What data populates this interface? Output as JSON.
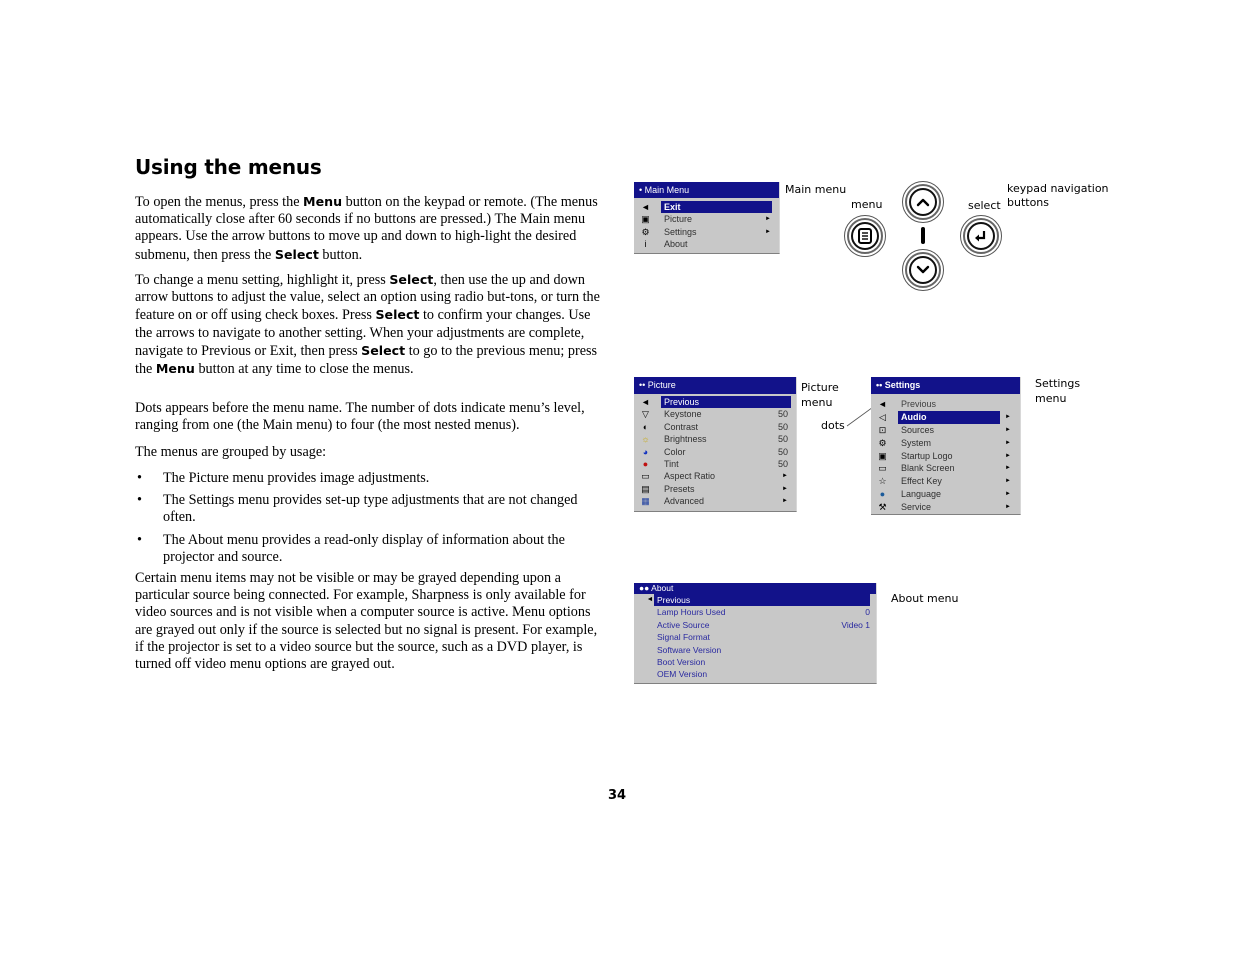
{
  "title": "Using the menus",
  "paragraphs": {
    "p1": [
      {
        "t": "To open the menus, press the "
      },
      {
        "b": "Menu"
      },
      {
        "t": " button on the keypad or remote. (The menus automatically close after 60 seconds if no buttons are pressed.) The Main menu appears. Use the arrow buttons to move up and down to high-light the desired submenu, then press the "
      },
      {
        "b": "Select"
      },
      {
        "t": " button."
      }
    ],
    "p2": [
      {
        "t": "To change a menu setting, highlight it, press "
      },
      {
        "b": "Select"
      },
      {
        "t": ", then use the up and down arrow buttons to adjust the value, select an option using radio but-tons, or turn the feature on or off using check boxes. Press "
      },
      {
        "b": "Select"
      },
      {
        "t": " to confirm your changes. Use the arrows to navigate to another setting. When your adjustments are complete, navigate to Previous or Exit, then press "
      },
      {
        "b": "Select"
      },
      {
        "t": " to go to the previous menu; press the "
      },
      {
        "b": "Menu"
      },
      {
        "t": " button at any time to close the menus."
      }
    ],
    "p3": "Dots appears before the menu name. The number of dots indicate menu’s level, ranging from one (the Main menu) to four (the most nested menus).",
    "p4": "The menus are grouped by usage:",
    "p5": "Certain menu items may not be visible or may be grayed depending upon a particular source being connected. For example, Sharpness is only available for video sources and is not visible when a computer source is active. Menu options are grayed out only if the source is selected but no signal is present. For example, if the projector is set to a video source but the source, such as a DVD player, is turned off video menu options are grayed out."
  },
  "bullets": [
    "The Picture menu provides image adjustments.",
    "The Settings menu provides set-up type adjustments that are not changed often.",
    "The About menu provides a read-only display of information about the projector and source."
  ],
  "bullet_glyph": "•",
  "page_number": "34",
  "labels": {
    "main_menu": "Main menu",
    "menu_key": "menu",
    "select_key": "select",
    "keypad_nav": "keypad navigation",
    "keypad_nav2": "buttons",
    "picture_menu": "Picture",
    "picture_menu2": "menu",
    "dots": "dots",
    "settings_menu": "Settings",
    "settings_menu2": "menu",
    "about_menu": "About menu"
  },
  "colors": {
    "osd_header": "#12128a",
    "osd_background": "#c8c8c8",
    "about_text": "#2a2aa0"
  },
  "main_menu": {
    "header": "•  Main Menu",
    "items": [
      {
        "icon": "◄",
        "icon_name": "back-arrow-icon",
        "label": "Exit",
        "selected": true,
        "submenu": ""
      },
      {
        "icon": "▣",
        "icon_name": "picture-icon",
        "label": "Picture",
        "selected": false,
        "submenu": "►"
      },
      {
        "icon": "⚙",
        "icon_name": "settings-icon",
        "label": "Settings",
        "selected": false,
        "submenu": "►"
      },
      {
        "icon": "i",
        "icon_name": "info-icon",
        "label": "About",
        "selected": false,
        "submenu": ""
      }
    ]
  },
  "picture_menu": {
    "header": "••  Picture",
    "items": [
      {
        "icon": "◄",
        "icon_name": "back-arrow-icon",
        "label": "Previous",
        "selected": true,
        "value": "",
        "submenu": ""
      },
      {
        "icon": "▽",
        "icon_name": "keystone-icon",
        "label": "Keystone",
        "value": "50",
        "submenu": ""
      },
      {
        "icon": "◐",
        "icon_name": "contrast-icon",
        "label": "Contrast",
        "value": "50",
        "submenu": ""
      },
      {
        "icon": "☼",
        "icon_name": "brightness-icon",
        "label": "Brightness",
        "value": "50",
        "submenu": ""
      },
      {
        "icon": "◕",
        "icon_name": "color-icon",
        "label": "Color",
        "value": "50",
        "submenu": ""
      },
      {
        "icon": "●",
        "icon_name": "tint-icon",
        "label": "Tint",
        "value": "50",
        "submenu": ""
      },
      {
        "icon": "▭",
        "icon_name": "aspect-ratio-icon",
        "label": "Aspect Ratio",
        "value": "",
        "submenu": "►"
      },
      {
        "icon": "▤",
        "icon_name": "presets-icon",
        "label": "Presets",
        "value": "",
        "submenu": "►"
      },
      {
        "icon": "▦",
        "icon_name": "advanced-icon",
        "label": "Advanced",
        "value": "",
        "submenu": "►"
      }
    ]
  },
  "settings_menu": {
    "header": "••  Settings",
    "items": [
      {
        "icon": "◄",
        "icon_name": "back-arrow-icon",
        "label": "Previous",
        "selected": false,
        "submenu": ""
      },
      {
        "icon": "◁",
        "icon_name": "audio-icon",
        "label": "Audio",
        "selected": true,
        "submenu": "►"
      },
      {
        "icon": "⊡",
        "icon_name": "sources-icon",
        "label": "Sources",
        "selected": false,
        "submenu": "►"
      },
      {
        "icon": "⚙",
        "icon_name": "system-icon",
        "label": "System",
        "selected": false,
        "submenu": "►"
      },
      {
        "icon": "▣",
        "icon_name": "startup-logo-icon",
        "label": "Startup Logo",
        "selected": false,
        "submenu": "►"
      },
      {
        "icon": "▭",
        "icon_name": "blank-screen-icon",
        "label": "Blank Screen",
        "selected": false,
        "submenu": "►"
      },
      {
        "icon": "☆",
        "icon_name": "effect-key-icon",
        "label": "Effect Key",
        "selected": false,
        "submenu": "►"
      },
      {
        "icon": "●",
        "icon_name": "language-globe-icon",
        "label": "Language",
        "selected": false,
        "submenu": "►"
      },
      {
        "icon": "⚒",
        "icon_name": "service-wrench-icon",
        "label": "Service",
        "selected": false,
        "submenu": "►"
      }
    ]
  },
  "about_menu": {
    "header": "●● About",
    "items": [
      {
        "icon": "◄",
        "label": "Previous",
        "selected": true,
        "value": ""
      },
      {
        "label": "Lamp Hours Used",
        "value": "0"
      },
      {
        "label": "Active Source",
        "value": "Video 1"
      },
      {
        "label": "Signal Format",
        "value": ""
      },
      {
        "label": "Software Version",
        "value": ""
      },
      {
        "label": "Boot Version",
        "value": ""
      },
      {
        "label": "OEM Version",
        "value": ""
      }
    ]
  }
}
